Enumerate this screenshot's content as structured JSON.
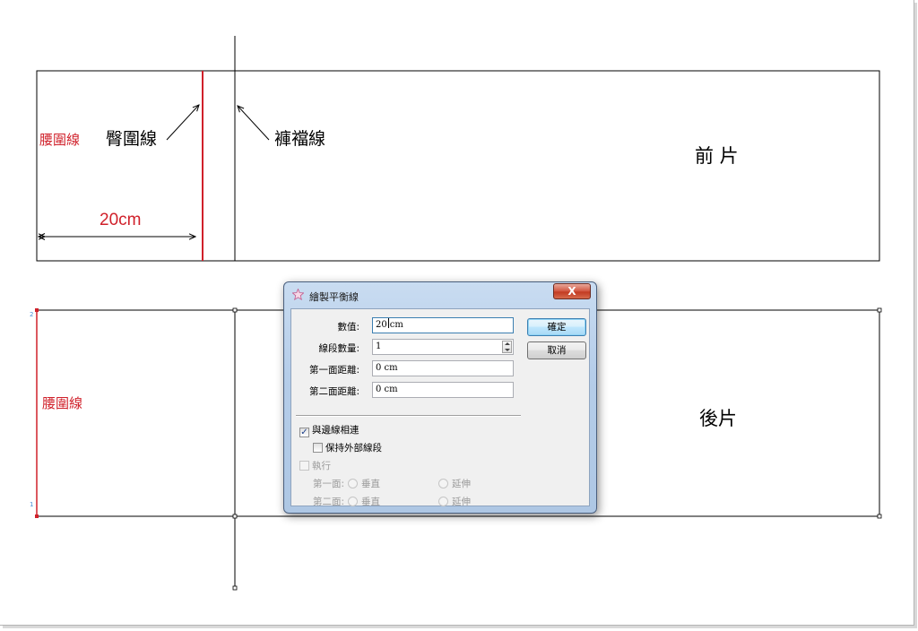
{
  "canvas": {
    "front": {
      "waist_label": "腰圍線",
      "hip_label": "臀圍線",
      "crotch_label": "褲襠線",
      "dimension_label": "20cm",
      "panel_label": "前 片"
    },
    "back": {
      "waist_label": "腰圍線",
      "panel_label": "後片",
      "node_top": "2",
      "node_bottom": "1"
    },
    "colors": {
      "line": "#000000",
      "accent_red": "#d0202a",
      "node_blue": "#4a90d9"
    }
  },
  "dialog": {
    "title": "繪製平衡線",
    "close_label": "X",
    "fields": {
      "value_label": "數值:",
      "value_text_before": "20",
      "value_text_after": "cm",
      "segments_label": "線段數量:",
      "segments_value": "1",
      "first_distance_label": "第一面距離:",
      "first_distance_value": "0 cm",
      "second_distance_label": "第二面距離:",
      "second_distance_value": "0 cm"
    },
    "buttons": {
      "ok": "確定",
      "cancel": "取消"
    },
    "options": {
      "connect_edge": "與邊線相連",
      "connect_edge_checked": "✓",
      "keep_outer": "保持外部線段",
      "execute": "執行",
      "first_side_label": "第一面:",
      "second_side_label": "第二面:",
      "vertical": "垂直",
      "extend": "延伸"
    }
  }
}
